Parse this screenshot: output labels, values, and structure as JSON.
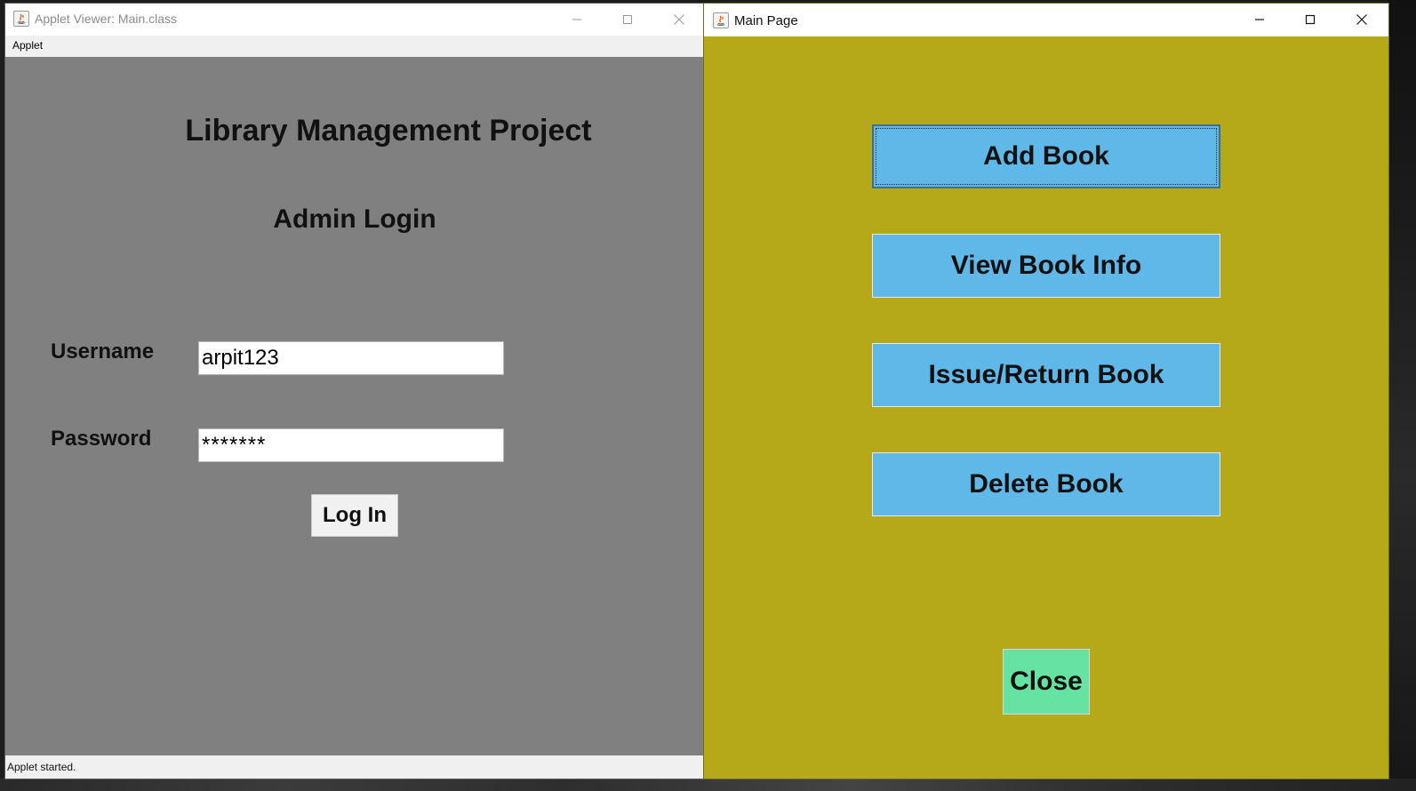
{
  "applet_window": {
    "title": "Applet Viewer: Main.class",
    "menu": [
      "Applet"
    ],
    "app_title": "Library Management Project",
    "subtitle": "Admin Login",
    "username_label": "Username",
    "username_value": "arpit123",
    "password_label": "Password",
    "password_value": "*******",
    "login_button": "Log In",
    "status": "Applet started.",
    "background_color": "#808080"
  },
  "main_page_window": {
    "title": "Main Page",
    "buttons": [
      {
        "label": "Add Book",
        "focused": true
      },
      {
        "label": "View Book Info"
      },
      {
        "label": "Issue/Return Book"
      },
      {
        "label": "Delete Book"
      }
    ],
    "close_button": "Close",
    "background_color": "#b5a91a",
    "button_color": "#5fb8e8",
    "close_button_color": "#66e3a2"
  },
  "icons": {
    "window_icon": "java-icon",
    "minimize": "minimize-icon",
    "maximize": "maximize-icon",
    "close": "close-icon"
  }
}
